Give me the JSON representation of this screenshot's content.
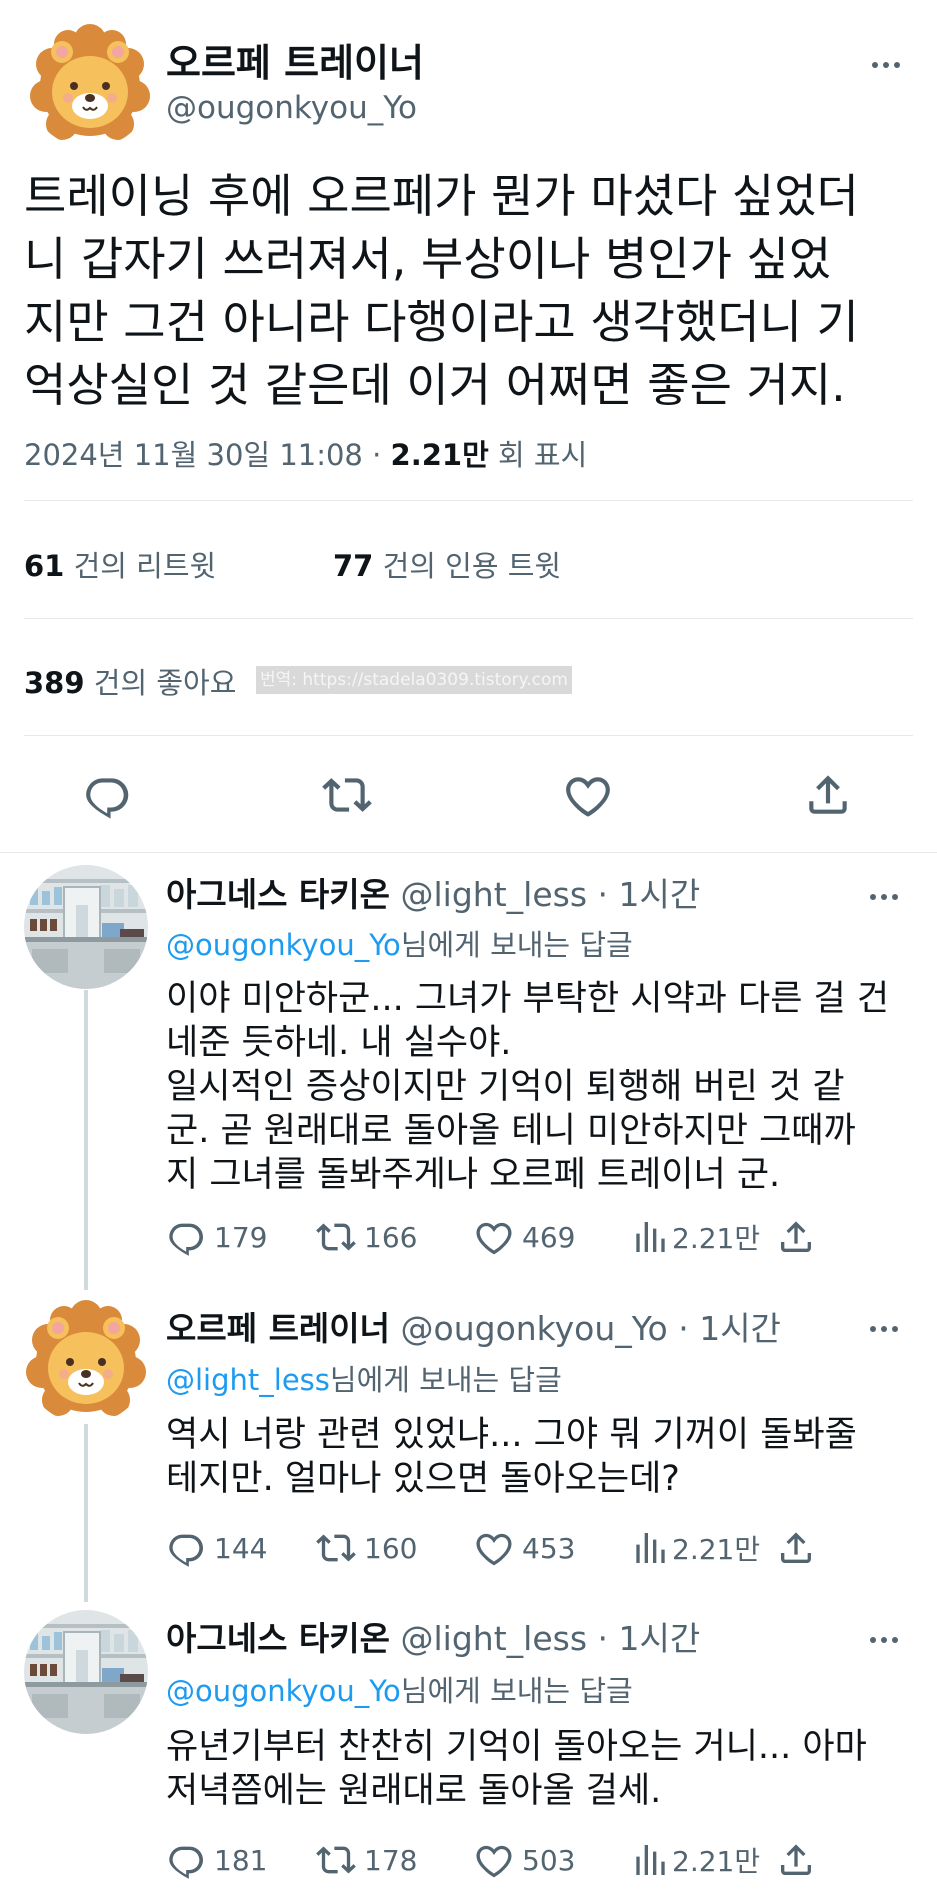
{
  "main_tweet": {
    "author_name": "오르페 트레이너",
    "author_handle": "@ougonkyou_Yo",
    "text_lines": [
      "트레이닝 후에 오르페가 뭔가 마셨다 싶었더",
      "니 갑자기 쓰러져서, 부상이나 병인가 싶었",
      "지만 그건 아니라 다행이라고 생각했더니 기",
      "억상실인 것 같은데 이거 어쩌면 좋은 거지."
    ],
    "date": "2024년 11월 30일",
    "time": "11:08",
    "views_count": "2.21만",
    "views_label": "회 표시",
    "retweets_count": "61",
    "retweets_label": "건의 리트윗",
    "quotes_count": "77",
    "quotes_label": "건의 인용 트윗",
    "likes_count": "389",
    "likes_label": "건의 좋아요",
    "watermark": "번역: https://stadela0309.tistory.com"
  },
  "replies": [
    {
      "author_name": "아그네스 타키온",
      "author_handle": "@light_less",
      "time": "· 1시간",
      "reply_to_handle": "@ougonkyou_Yo",
      "reply_to_suffix": "님에게 보내는 답글",
      "text_lines": [
        "이야 미안하군... 그녀가 부탁한 시약과 다른 걸 건",
        "네준 듯하네. 내 실수야.",
        "일시적인 증상이지만 기억이 퇴행해 버린 것 같",
        "군. 곧 원래대로 돌아올 테니 미안하지만 그때까",
        "지 그녀를 돌봐주게나 오르페 트레이너 군."
      ],
      "reply_count": "179",
      "retweet_count": "166",
      "like_count": "469",
      "view_count": "2.21만"
    },
    {
      "author_name": "오르페 트레이너",
      "author_handle": "@ougonkyou_Yo",
      "time": "· 1시간",
      "reply_to_handle": "@light_less",
      "reply_to_suffix": "님에게 보내는 답글",
      "text_lines": [
        "역시 너랑 관련 있었냐... 그야 뭐 기꺼이 돌봐줄",
        "테지만. 얼마나 있으면 돌아오는데?"
      ],
      "reply_count": "144",
      "retweet_count": "160",
      "like_count": "453",
      "view_count": "2.21만"
    },
    {
      "author_name": "아그네스 타키온",
      "author_handle": "@light_less",
      "time": "· 1시간",
      "reply_to_handle": "@ougonkyou_Yo",
      "reply_to_suffix": "님에게 보내는 답글",
      "text_lines": [
        "유년기부터 찬찬히 기억이 돌아오는 거니... 아마",
        "저녁쯤에는 원래대로 돌아올 걸세."
      ],
      "reply_count": "181",
      "retweet_count": "178",
      "like_count": "503",
      "view_count": "2.21만"
    }
  ],
  "icons": [
    "more-icon",
    "reply-icon",
    "retweet-icon",
    "like-icon",
    "share-icon",
    "views-icon"
  ],
  "colors": {
    "link": "#1d9bf0",
    "secondary_text": "#536471",
    "divider": "#e6e9eb",
    "lion_mane": "#d98a3a",
    "lion_face": "#f6c05c"
  }
}
